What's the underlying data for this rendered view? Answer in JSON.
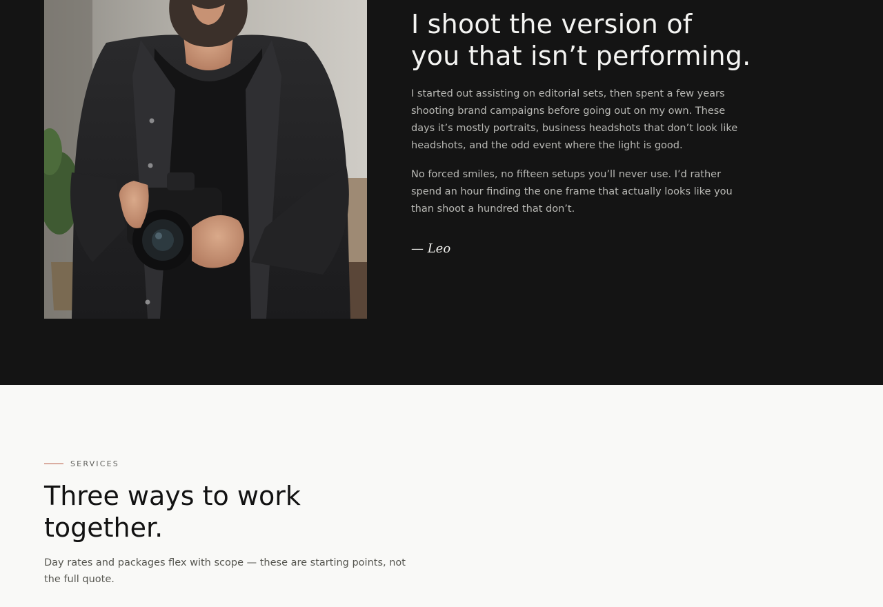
{
  "about": {
    "image_alt": "Photographer holding a camera",
    "title_line1": "I shoot the version of",
    "title_line2": "you that isn’t performing.",
    "paragraph1": "I started out assisting on editorial sets, then spent a few years shooting brand campaigns before going out on my own. These days it’s mostly portraits, business headshots that don’t look like headshots, and the odd event where the light is good.",
    "paragraph2": "No forced smiles, no fifteen setups you’ll never use. I’d rather spend an hour finding the one frame that actually looks like you than shoot a hundred that don’t.",
    "signature": "— Leo"
  },
  "services": {
    "eyebrow": "SERVICES",
    "title_line1": "Three ways to work",
    "title_line2": "together.",
    "subtitle": "Day rates and packages flex with scope — these are starting points, not the full quote."
  },
  "colors": {
    "dark_bg": "#141414",
    "light_bg": "#f9f9f7",
    "accent": "#b5553d"
  }
}
